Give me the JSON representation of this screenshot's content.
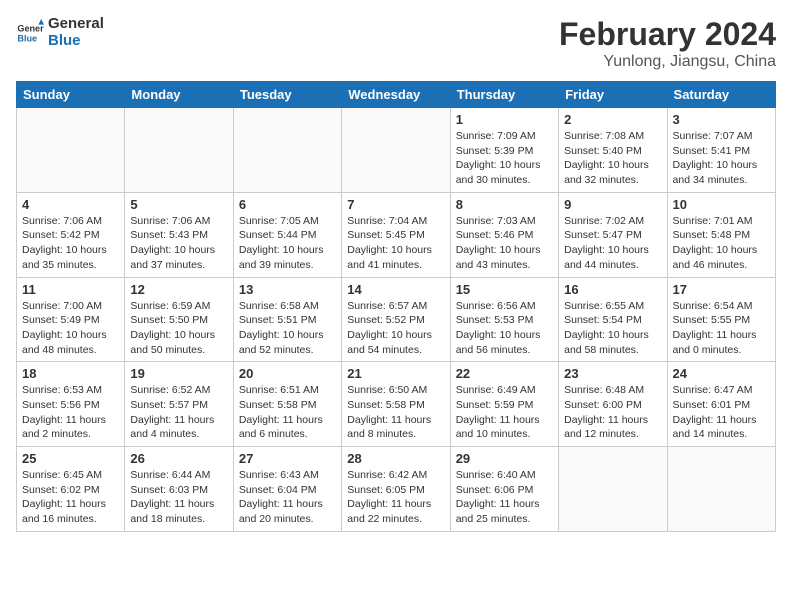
{
  "logo": {
    "text_general": "General",
    "text_blue": "Blue"
  },
  "header": {
    "title": "February 2024",
    "subtitle": "Yunlong, Jiangsu, China"
  },
  "weekdays": [
    "Sunday",
    "Monday",
    "Tuesday",
    "Wednesday",
    "Thursday",
    "Friday",
    "Saturday"
  ],
  "weeks": [
    [
      {
        "day": "",
        "info": ""
      },
      {
        "day": "",
        "info": ""
      },
      {
        "day": "",
        "info": ""
      },
      {
        "day": "",
        "info": ""
      },
      {
        "day": "1",
        "info": "Sunrise: 7:09 AM\nSunset: 5:39 PM\nDaylight: 10 hours\nand 30 minutes."
      },
      {
        "day": "2",
        "info": "Sunrise: 7:08 AM\nSunset: 5:40 PM\nDaylight: 10 hours\nand 32 minutes."
      },
      {
        "day": "3",
        "info": "Sunrise: 7:07 AM\nSunset: 5:41 PM\nDaylight: 10 hours\nand 34 minutes."
      }
    ],
    [
      {
        "day": "4",
        "info": "Sunrise: 7:06 AM\nSunset: 5:42 PM\nDaylight: 10 hours\nand 35 minutes."
      },
      {
        "day": "5",
        "info": "Sunrise: 7:06 AM\nSunset: 5:43 PM\nDaylight: 10 hours\nand 37 minutes."
      },
      {
        "day": "6",
        "info": "Sunrise: 7:05 AM\nSunset: 5:44 PM\nDaylight: 10 hours\nand 39 minutes."
      },
      {
        "day": "7",
        "info": "Sunrise: 7:04 AM\nSunset: 5:45 PM\nDaylight: 10 hours\nand 41 minutes."
      },
      {
        "day": "8",
        "info": "Sunrise: 7:03 AM\nSunset: 5:46 PM\nDaylight: 10 hours\nand 43 minutes."
      },
      {
        "day": "9",
        "info": "Sunrise: 7:02 AM\nSunset: 5:47 PM\nDaylight: 10 hours\nand 44 minutes."
      },
      {
        "day": "10",
        "info": "Sunrise: 7:01 AM\nSunset: 5:48 PM\nDaylight: 10 hours\nand 46 minutes."
      }
    ],
    [
      {
        "day": "11",
        "info": "Sunrise: 7:00 AM\nSunset: 5:49 PM\nDaylight: 10 hours\nand 48 minutes."
      },
      {
        "day": "12",
        "info": "Sunrise: 6:59 AM\nSunset: 5:50 PM\nDaylight: 10 hours\nand 50 minutes."
      },
      {
        "day": "13",
        "info": "Sunrise: 6:58 AM\nSunset: 5:51 PM\nDaylight: 10 hours\nand 52 minutes."
      },
      {
        "day": "14",
        "info": "Sunrise: 6:57 AM\nSunset: 5:52 PM\nDaylight: 10 hours\nand 54 minutes."
      },
      {
        "day": "15",
        "info": "Sunrise: 6:56 AM\nSunset: 5:53 PM\nDaylight: 10 hours\nand 56 minutes."
      },
      {
        "day": "16",
        "info": "Sunrise: 6:55 AM\nSunset: 5:54 PM\nDaylight: 10 hours\nand 58 minutes."
      },
      {
        "day": "17",
        "info": "Sunrise: 6:54 AM\nSunset: 5:55 PM\nDaylight: 11 hours\nand 0 minutes."
      }
    ],
    [
      {
        "day": "18",
        "info": "Sunrise: 6:53 AM\nSunset: 5:56 PM\nDaylight: 11 hours\nand 2 minutes."
      },
      {
        "day": "19",
        "info": "Sunrise: 6:52 AM\nSunset: 5:57 PM\nDaylight: 11 hours\nand 4 minutes."
      },
      {
        "day": "20",
        "info": "Sunrise: 6:51 AM\nSunset: 5:58 PM\nDaylight: 11 hours\nand 6 minutes."
      },
      {
        "day": "21",
        "info": "Sunrise: 6:50 AM\nSunset: 5:58 PM\nDaylight: 11 hours\nand 8 minutes."
      },
      {
        "day": "22",
        "info": "Sunrise: 6:49 AM\nSunset: 5:59 PM\nDaylight: 11 hours\nand 10 minutes."
      },
      {
        "day": "23",
        "info": "Sunrise: 6:48 AM\nSunset: 6:00 PM\nDaylight: 11 hours\nand 12 minutes."
      },
      {
        "day": "24",
        "info": "Sunrise: 6:47 AM\nSunset: 6:01 PM\nDaylight: 11 hours\nand 14 minutes."
      }
    ],
    [
      {
        "day": "25",
        "info": "Sunrise: 6:45 AM\nSunset: 6:02 PM\nDaylight: 11 hours\nand 16 minutes."
      },
      {
        "day": "26",
        "info": "Sunrise: 6:44 AM\nSunset: 6:03 PM\nDaylight: 11 hours\nand 18 minutes."
      },
      {
        "day": "27",
        "info": "Sunrise: 6:43 AM\nSunset: 6:04 PM\nDaylight: 11 hours\nand 20 minutes."
      },
      {
        "day": "28",
        "info": "Sunrise: 6:42 AM\nSunset: 6:05 PM\nDaylight: 11 hours\nand 22 minutes."
      },
      {
        "day": "29",
        "info": "Sunrise: 6:40 AM\nSunset: 6:06 PM\nDaylight: 11 hours\nand 25 minutes."
      },
      {
        "day": "",
        "info": ""
      },
      {
        "day": "",
        "info": ""
      }
    ]
  ]
}
